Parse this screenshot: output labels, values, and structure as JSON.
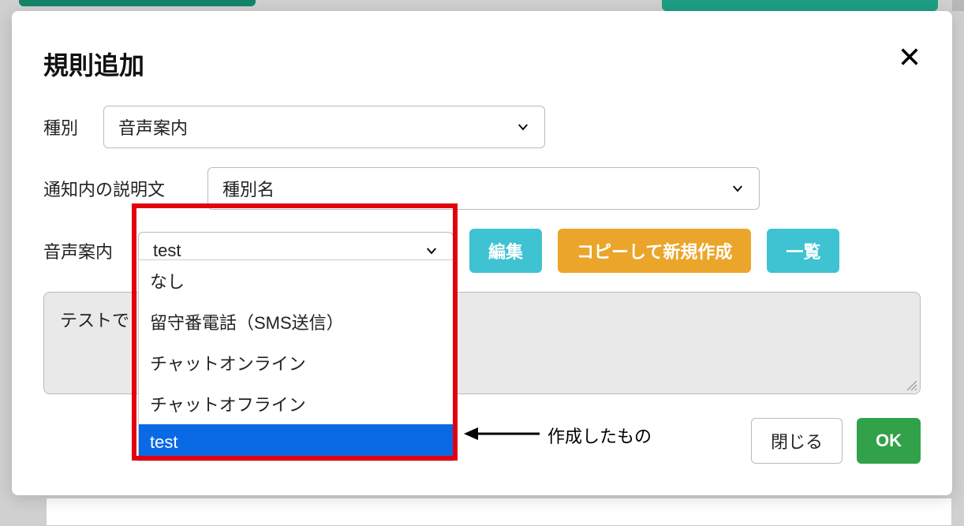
{
  "modal": {
    "title": "規則追加",
    "fields": {
      "type": {
        "label": "種別",
        "value": "音声案内"
      },
      "description": {
        "label": "通知内の説明文",
        "value": "種別名"
      },
      "voice_guide": {
        "label": "音声案内",
        "value": "test",
        "options": [
          "なし",
          "留守番電話（SMS送信）",
          "チャットオンライン",
          "チャットオフライン",
          "test"
        ],
        "selected_index": 4
      }
    },
    "buttons": {
      "edit": "編集",
      "copy_new": "コピーして新規作成",
      "list": "一覧",
      "close": "閉じる",
      "ok": "OK"
    },
    "textarea_content": "テストで"
  },
  "annotation": {
    "label": "作成したもの"
  }
}
